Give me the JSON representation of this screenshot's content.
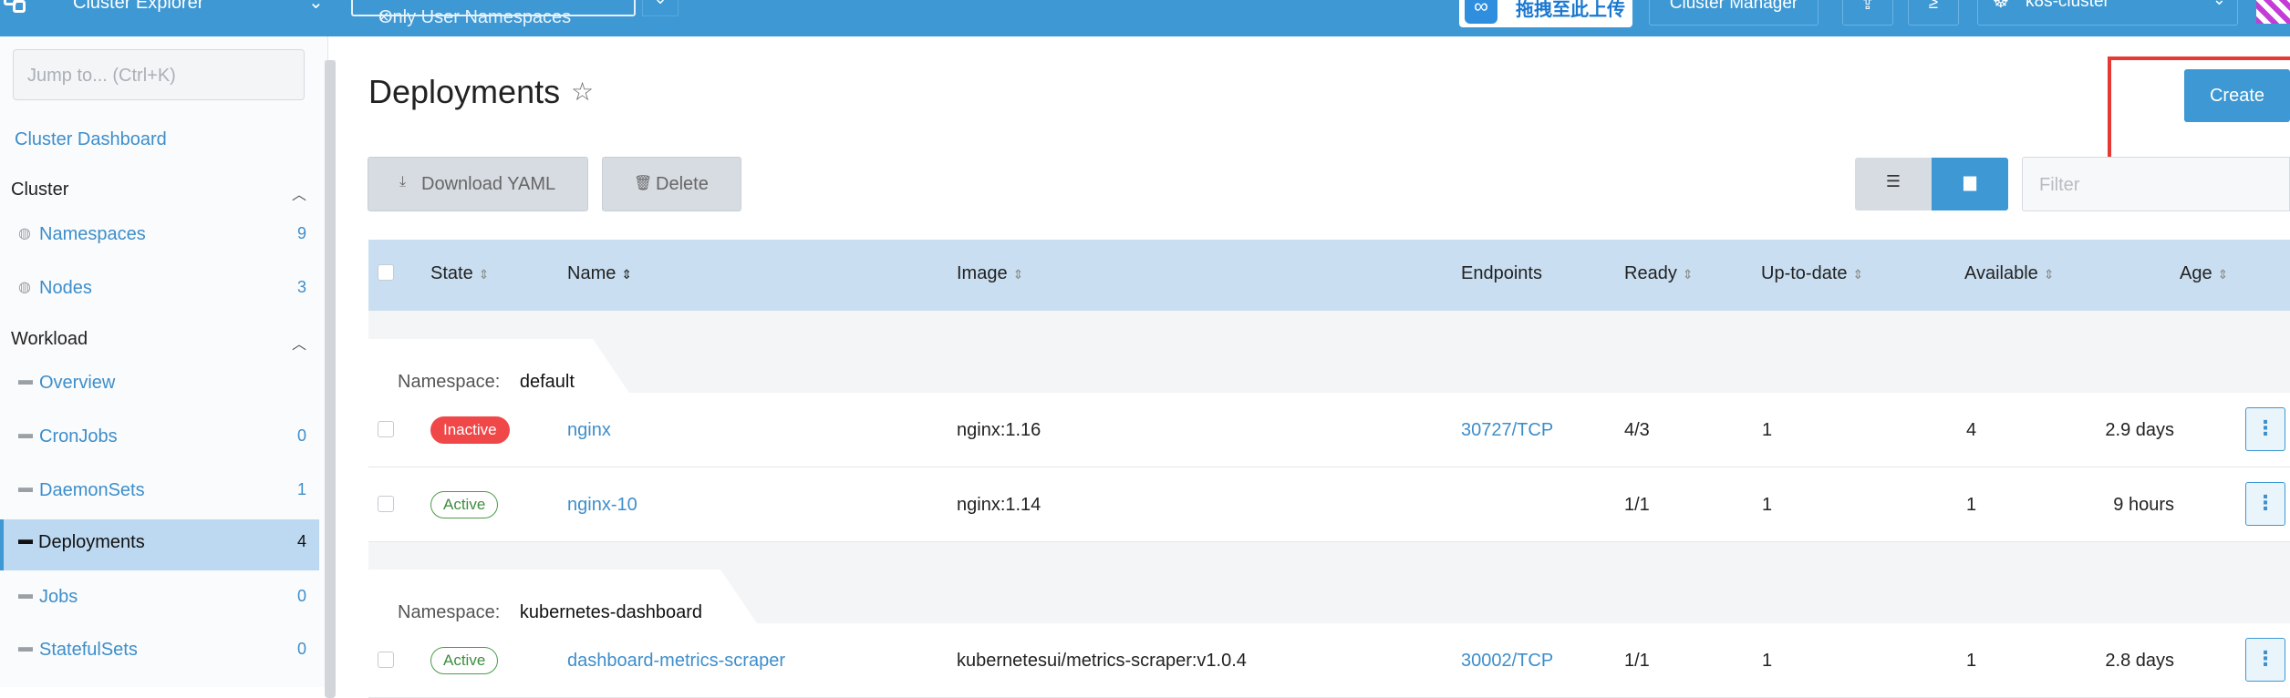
{
  "topbar": {
    "app_title": "Cluster Explorer",
    "namespace_filter": "Only User Namespaces",
    "namespace_filter_clear": "×",
    "upload_badge_text": "拖拽至此上传",
    "cluster_manager_label": "Cluster Manager",
    "cluster_name": "k8s-cluster",
    "icons": [
      "rancher-logo-icon",
      "chevron-down-icon",
      "upload-cloud-icon",
      "import-yaml-icon",
      "kubectl-shell-icon",
      "cluster-icon",
      "user-avatar-icon"
    ]
  },
  "sidebar": {
    "jump_placeholder": "Jump to... (Ctrl+K)",
    "dashboard_link": "Cluster Dashboard",
    "sections": [
      {
        "title": "Cluster",
        "items": [
          {
            "label": "Namespaces",
            "count": "9",
            "icon": "globe-icon"
          },
          {
            "label": "Nodes",
            "count": "3",
            "icon": "globe-icon"
          }
        ]
      },
      {
        "title": "Workload",
        "items": [
          {
            "label": "Overview",
            "count": "",
            "icon": "folder-icon"
          },
          {
            "label": "CronJobs",
            "count": "0",
            "icon": "folder-icon"
          },
          {
            "label": "DaemonSets",
            "count": "1",
            "icon": "folder-icon"
          },
          {
            "label": "Deployments",
            "count": "4",
            "icon": "folder-icon",
            "active": true
          },
          {
            "label": "Jobs",
            "count": "0",
            "icon": "folder-icon"
          },
          {
            "label": "StatefulSets",
            "count": "0",
            "icon": "folder-icon"
          }
        ]
      }
    ]
  },
  "main": {
    "title": "Deployments",
    "create_label": "Create",
    "download_yaml_label": "Download YAML",
    "delete_label": "Delete",
    "filter_placeholder": "Filter",
    "columns": [
      "State",
      "Name",
      "Image",
      "Endpoints",
      "Ready",
      "Up-to-date",
      "Available",
      "Age"
    ],
    "groups": [
      {
        "label": "Namespace:",
        "value": "default",
        "rows": [
          {
            "state": "Inactive",
            "name": "nginx",
            "image": "nginx:1.16",
            "endpoints": "30727/TCP",
            "ready": "4/3",
            "uptodate": "1",
            "available": "4",
            "age": "2.9 days"
          },
          {
            "state": "Active",
            "name": "nginx-10",
            "image": "nginx:1.14",
            "endpoints": "",
            "ready": "1/1",
            "uptodate": "1",
            "available": "1",
            "age": "9 hours"
          }
        ]
      },
      {
        "label": "Namespace:",
        "value": "kubernetes-dashboard",
        "rows": [
          {
            "state": "Active",
            "name": "dashboard-metrics-scraper",
            "image": "kubernetesui/metrics-scraper:v1.0.4",
            "endpoints": "30002/TCP",
            "ready": "1/1",
            "uptodate": "1",
            "available": "1",
            "age": "2.8 days"
          }
        ]
      }
    ]
  },
  "colors": {
    "brand": "#3d98d3",
    "active_nav": "#bcd9f1",
    "inactive_badge": "#f04848",
    "active_badge": "#4b9b4b",
    "highlight_box": "#e53935"
  }
}
